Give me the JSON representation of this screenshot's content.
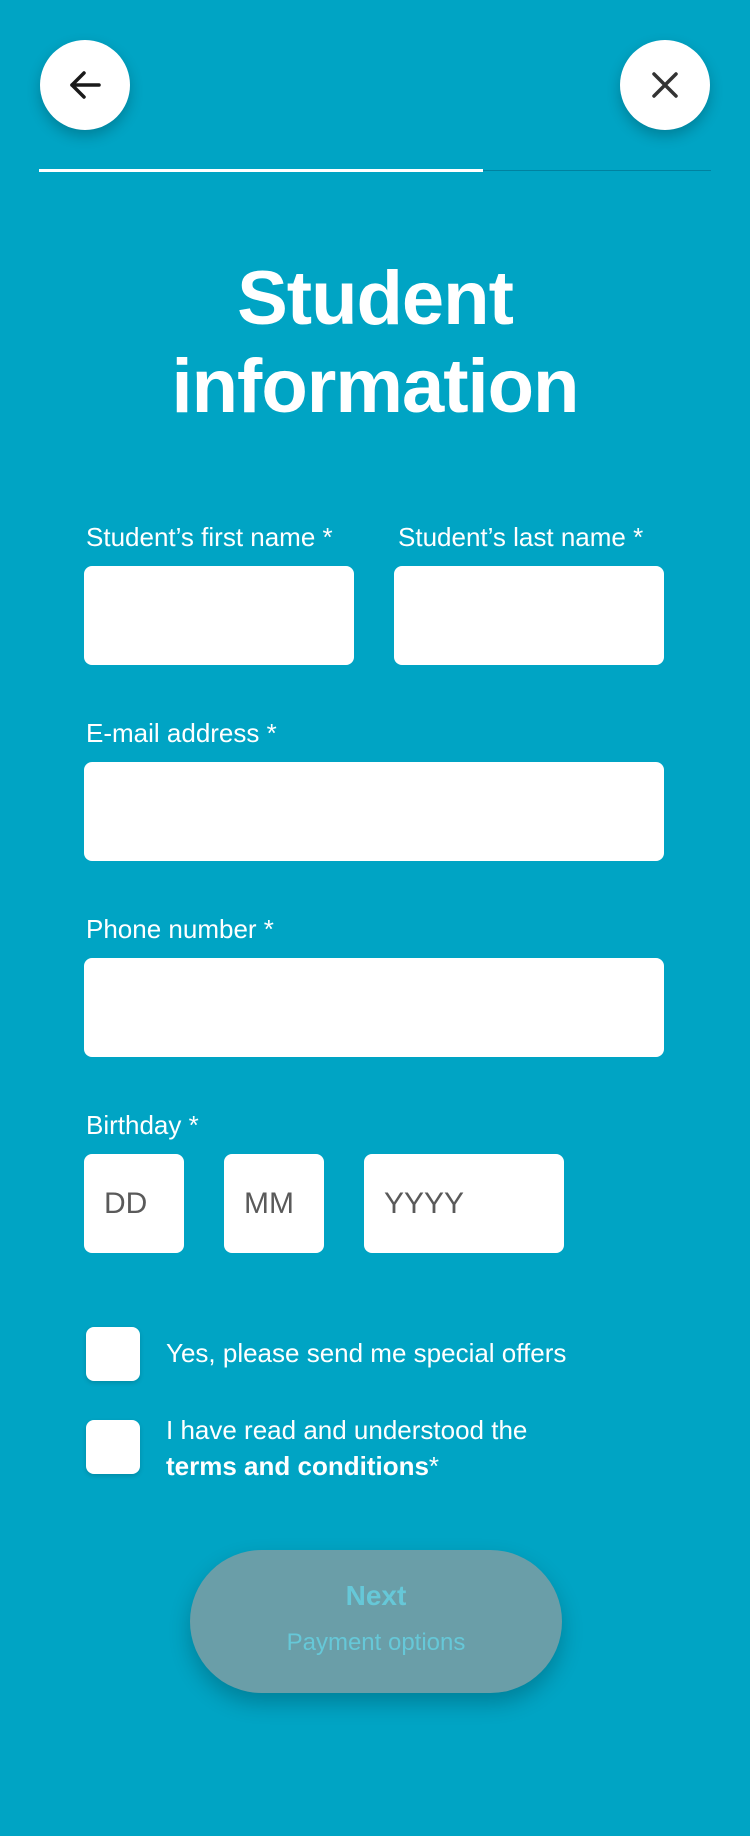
{
  "header": {
    "back_icon": "arrow-left-icon",
    "close_icon": "close-icon",
    "progress": 0.66
  },
  "page": {
    "title_line1": "Student",
    "title_line2": "information"
  },
  "form": {
    "first_name_label": "Student’s first name *",
    "first_name_value": "",
    "last_name_label": "Student’s last name *",
    "last_name_value": "",
    "email_label": "E-mail address *",
    "email_value": "",
    "phone_label": "Phone number *",
    "phone_value": "",
    "birthday_label": "Birthday *",
    "day_placeholder": "DD",
    "month_placeholder": "MM",
    "year_placeholder": "YYYY"
  },
  "checkboxes": {
    "offers_text": "Yes, please send me special offers",
    "offers_checked": false,
    "terms_text": "I have read and understood the",
    "terms_link": "terms and conditions",
    "terms_suffix": "*",
    "terms_checked": false
  },
  "next_button": {
    "label": "Next",
    "sublabel": "Payment options",
    "enabled": false
  },
  "colors": {
    "background": "#00a4c4",
    "button_disabled": "#6a9ea8",
    "button_text_disabled": "#66c8d8"
  }
}
